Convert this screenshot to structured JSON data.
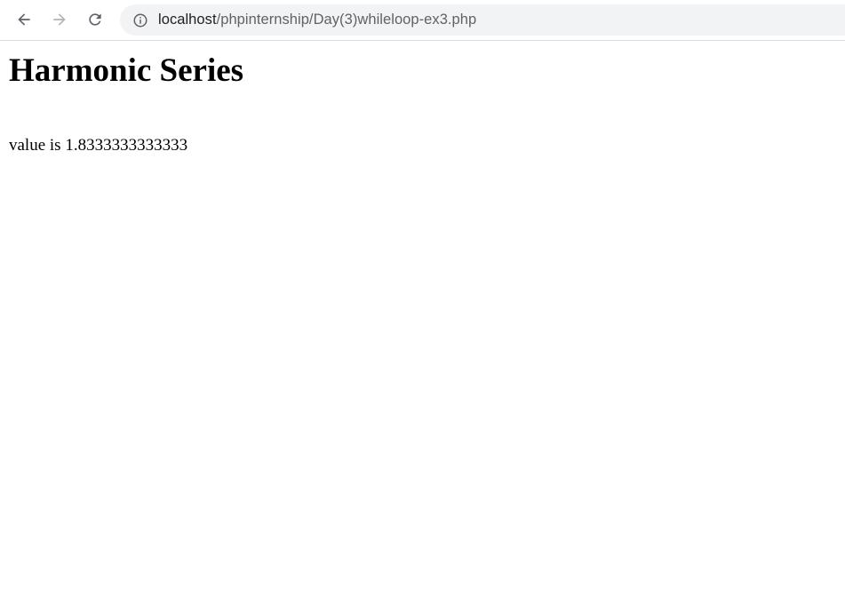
{
  "browser": {
    "url_host": "localhost",
    "url_path": "/phpinternship/Day(3)whileloop-ex3.php",
    "icons": {
      "back": "arrow-left-icon",
      "forward": "arrow-right-icon",
      "reload": "reload-icon",
      "site_info": "info-icon"
    },
    "colors": {
      "omnibox_bg": "#f1f3f4",
      "host_text": "#202124",
      "path_text": "#5f6368",
      "forward_disabled": "#b3b3b3"
    }
  },
  "page": {
    "title": "Harmonic Series",
    "result_text": "value is 1.8333333333333"
  }
}
